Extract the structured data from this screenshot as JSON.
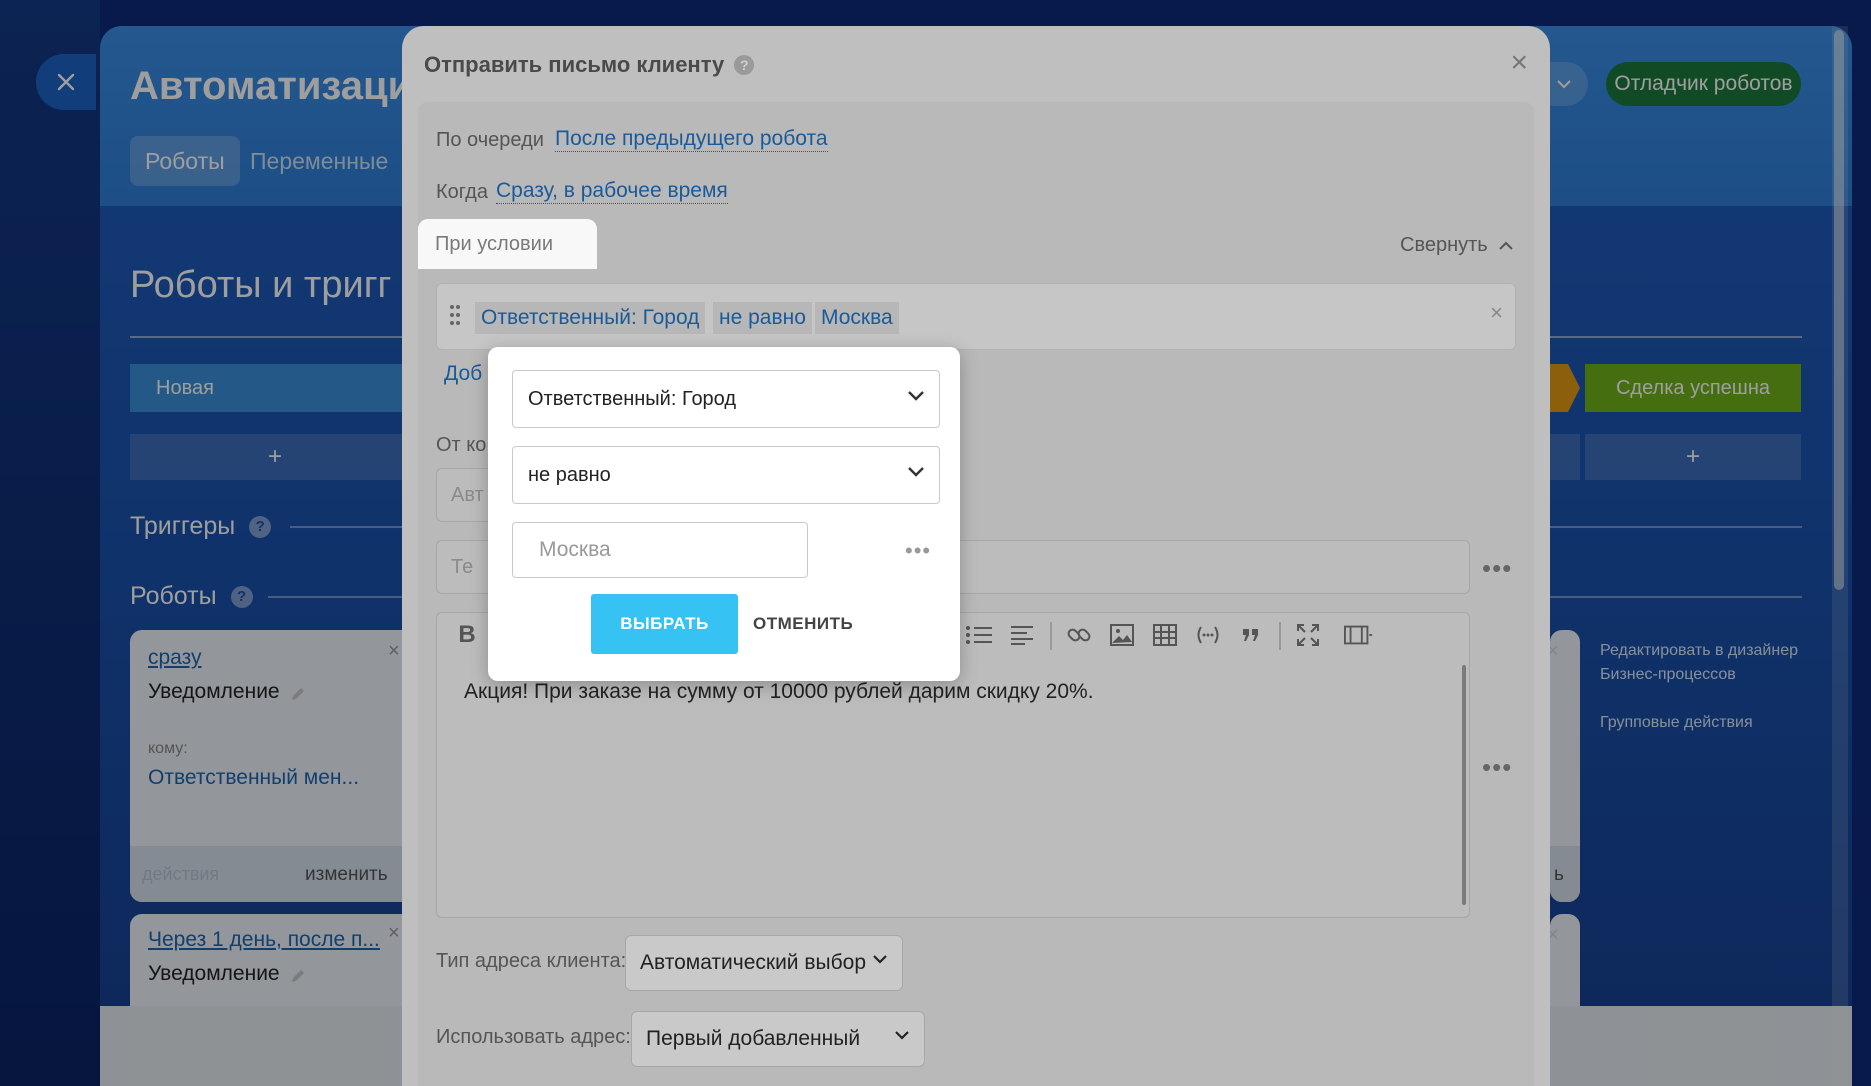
{
  "outer": {
    "page_title": "Автоматизация",
    "tabs": [
      "Роботы",
      "Переменные"
    ],
    "debugger_button": "Отладчик роботов",
    "section_title": "Роботы и тригг",
    "stages": [
      {
        "label": "Новая",
        "color": "#3a8fd8"
      },
      {
        "label": "Сделка успешна",
        "color": "#6fb21a"
      }
    ],
    "plus_label": "+",
    "triggers_title": "Триггеры",
    "robots_title": "Роботы",
    "help_glyph": "?",
    "card1": {
      "link": "сразу",
      "type": "Уведомление",
      "to_label": "кому:",
      "to_value": "Ответственный мен...",
      "footer_left": "действия",
      "footer_right": "изменить",
      "close_glyph": "×"
    },
    "card2": {
      "link": "Через 1 день, после п...",
      "type": "Уведомление",
      "close_glyph": "×"
    },
    "right_card_footer": "ь",
    "side_links": [
      "Редактировать в дизайнер",
      "Бизнес-процессов",
      "Групповые действия"
    ]
  },
  "dialog": {
    "title": "Отправить письмо клиенту",
    "help_glyph": "?",
    "close_glyph": "×",
    "order_label": "По очереди",
    "order_value": "После предыдущего робота",
    "when_label": "Когда",
    "when_value": "Сразу, в рабочее время",
    "condition_tab": "При условии",
    "collapse_label": "Свернуть",
    "condition_chips": [
      "Ответственный: Город",
      "не равно",
      "Москва"
    ],
    "condition_remove": "×",
    "add_link_partial": "Доб",
    "from_label_partial": "От ко",
    "from_field_partial": "Авт",
    "subject_field_partial": "Те",
    "more_glyph": "•••",
    "editor_text": "Акция! При заказе на сумму от 10000 рублей дарим скидку 20%.",
    "toolbar_bold": "B",
    "address_type_label": "Тип адреса клиента:",
    "address_type_value": "Автоматический выбор",
    "use_address_label": "Использовать адрес:",
    "use_address_value": "Первый добавленный"
  },
  "popup": {
    "field_select": "Ответственный: Город",
    "operator_select": "не равно",
    "value_placeholder": "Москва",
    "more_glyph": "•••",
    "ok_button": "ВЫБРАТЬ",
    "cancel_button": "ОТМЕНИТЬ"
  },
  "colors": {
    "accent": "#36c2f2",
    "link": "#2067b0",
    "debug_green": "#1c7a3e"
  }
}
